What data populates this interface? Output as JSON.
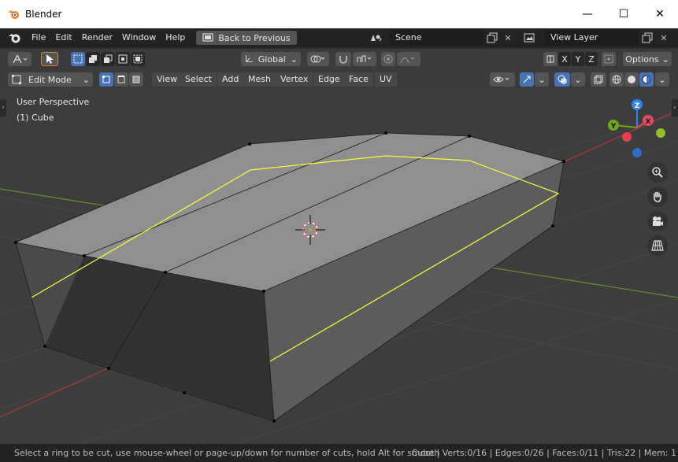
{
  "window": {
    "title": "Blender",
    "controls": {
      "minimize": "—",
      "maximize": "☐",
      "close": "✕"
    }
  },
  "topbar": {
    "menus": [
      "File",
      "Edit",
      "Render",
      "Window",
      "Help"
    ],
    "back_button": "Back to Previous",
    "scene": "Scene",
    "view_layer": "View Layer"
  },
  "toolbar": {
    "transform_orientation": "Global",
    "axes": [
      "X",
      "Y",
      "Z"
    ],
    "options": "Options"
  },
  "header": {
    "mode": "Edit Mode",
    "menus": [
      "View",
      "Select",
      "Add",
      "Mesh",
      "Vertex",
      "Edge",
      "Face",
      "UV"
    ]
  },
  "viewport": {
    "perspective_label": "User Perspective",
    "object_label": "(1) Cube",
    "gizmo_axes": {
      "z": "Z",
      "y": "Y",
      "x": "X"
    }
  },
  "statusbar": {
    "hint": "Select a ring to be cut, use mouse-wheel or page-up/down for number of cuts, hold Alt for smooth",
    "stats": "Cube | Verts:0/16 | Edges:0/26 | Faces:0/11 | Tris:22 | Mem: 1"
  },
  "colors": {
    "grid_x_axis": "#a33a3a",
    "grid_y_axis": "#6b8a2d",
    "loop_cut_highlight": "#ffff33",
    "active_blue": "#4772b3",
    "viewport_bg": "#3d3d3d"
  }
}
